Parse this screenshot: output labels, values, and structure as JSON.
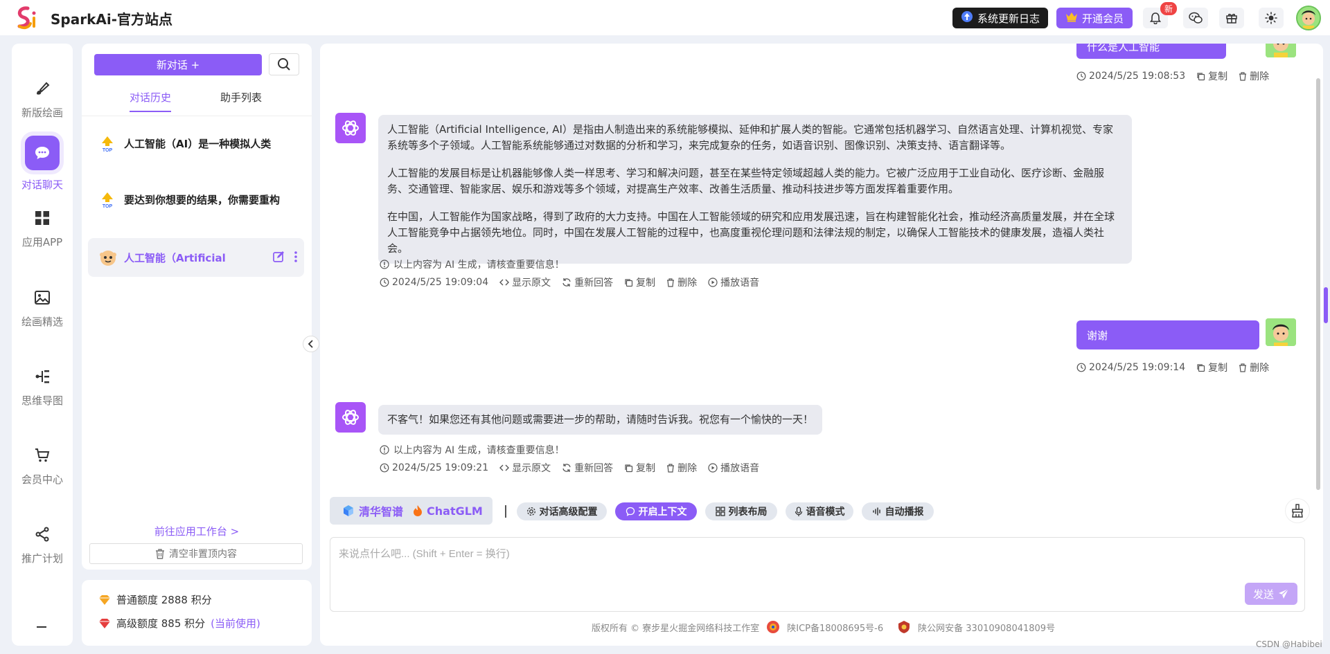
{
  "header": {
    "site_title": "SparkAi-官方站点",
    "logo_text": "Si",
    "changelog_label": "系统更新日志",
    "vip_label": "开通会员",
    "new_badge": "新"
  },
  "rail": {
    "items": [
      {
        "label": "新版绘画",
        "icon": "brush-icon"
      },
      {
        "label": "对话聊天",
        "icon": "chat-bubble-icon"
      },
      {
        "label": "应用APP",
        "icon": "grid-icon"
      },
      {
        "label": "绘画精选",
        "icon": "image-icon"
      },
      {
        "label": "思维导图",
        "icon": "mindmap-icon"
      },
      {
        "label": "会员中心",
        "icon": "cart-icon"
      },
      {
        "label": "推广计划",
        "icon": "share-icon"
      }
    ]
  },
  "conversations": {
    "new_chat_label": "新对话 +",
    "tabs": [
      "对话历史",
      "助手列表"
    ],
    "items": [
      {
        "title": "人工智能（AI）是一种模拟人类"
      },
      {
        "title": "要达到你想要的结果，你需要重构"
      },
      {
        "title": "人工智能（Artificial"
      }
    ],
    "top_badge": "TOP",
    "workbench_link": "前往应用工作台 >",
    "clear_label": "清空非置顶内容"
  },
  "points": {
    "normal": "普通额度 2888 积分",
    "advanced": "高级额度 885 积分",
    "current": "(当前使用)"
  },
  "chat": {
    "messages": [
      {
        "role": "user",
        "text": "什么是人工智能",
        "time": "2024/5/25 19:08:53",
        "actions": [
          "复制",
          "删除"
        ]
      },
      {
        "role": "assistant",
        "paragraphs": [
          "人工智能（Artificial Intelligence, AI）是指由人制造出来的系统能够模拟、延伸和扩展人类的智能。它通常包括机器学习、自然语言处理、计算机视觉、专家系统等多个子领域。人工智能系统能够通过对数据的分析和学习，来完成复杂的任务，如语音识别、图像识别、决策支持、语言翻译等。",
          "人工智能的发展目标是让机器能够像人类一样思考、学习和解决问题，甚至在某些特定领域超越人类的能力。它被广泛应用于工业自动化、医疗诊断、金融服务、交通管理、智能家居、娱乐和游戏等多个领域，对提高生产效率、改善生活质量、推动科技进步等方面发挥着重要作用。",
          "在中国，人工智能作为国家战略，得到了政府的大力支持。中国在人工智能领域的研究和应用发展迅速，旨在构建智能化社会，推动经济高质量发展，并在全球人工智能竞争中占据领先地位。同时，中国在发展人工智能的过程中，也高度重视伦理问题和法律法规的制定，以确保人工智能技术的健康发展，造福人类社会。"
        ],
        "notice": "以上内容为 AI 生成，请核查重要信息！",
        "time": "2024/5/25 19:09:04",
        "actions": [
          "显示原文",
          "重新回答",
          "复制",
          "删除",
          "播放语音"
        ]
      },
      {
        "role": "user",
        "text": "谢谢",
        "time": "2024/5/25 19:09:14",
        "actions": [
          "复制",
          "删除"
        ]
      },
      {
        "role": "assistant",
        "paragraphs": [
          "不客气！如果您还有其他问题或需要进一步的帮助，请随时告诉我。祝您有一个愉快的一天！"
        ],
        "notice": "以上内容为 AI 生成，请核查重要信息！",
        "time": "2024/5/25 19:09:21",
        "actions": [
          "显示原文",
          "重新回答",
          "复制",
          "删除",
          "播放语音"
        ]
      }
    ],
    "model_provider": "清华智谱",
    "model_name": "ChatGLM",
    "tools": [
      "对话高级配置",
      "开启上下文",
      "列表布局",
      "语音模式",
      "自动播报"
    ],
    "input_placeholder": "来说点什么吧... (Shift + Enter = 换行)",
    "send_label": "发送"
  },
  "footer": {
    "copyright": "版权所有 © 寮步星火掘金网络科技工作室",
    "icp": "陕ICP备18008695号-6",
    "police": "陕公网安备 33010908041809号"
  },
  "watermark": "CSDN @Habibei",
  "colors": {
    "accent": "#8b5cf6",
    "header_bg": "#ffffff",
    "page_bg": "#eef1f7"
  }
}
